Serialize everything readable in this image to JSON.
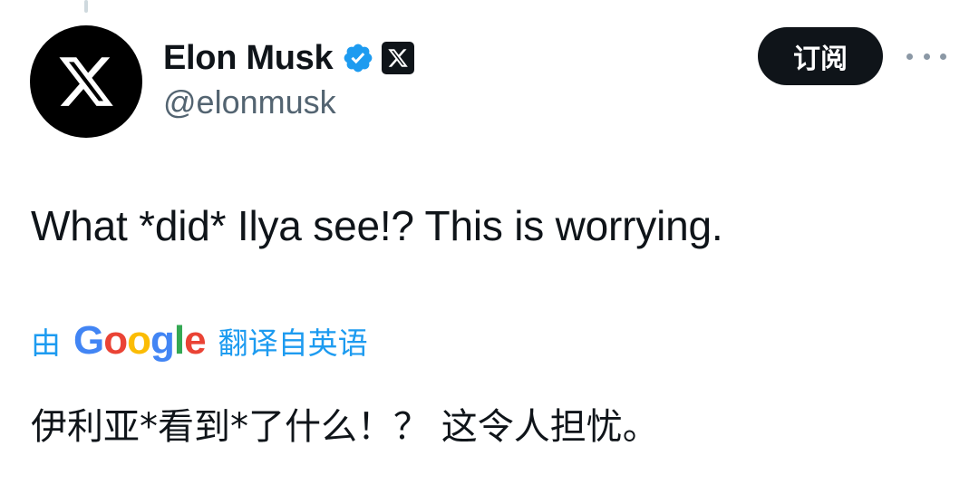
{
  "author": {
    "display_name": "Elon Musk",
    "handle": "@elonmusk",
    "avatar_icon": "x-logo-icon",
    "verified_icon": "verified-badge-icon",
    "affiliation_icon": "x-logo-badge-icon"
  },
  "actions": {
    "subscribe_label": "订阅",
    "more_icon": "more-options-icon"
  },
  "tweet": {
    "text": "What *did* Ilya see!? This is worrying."
  },
  "translation": {
    "by_label": "由",
    "provider": "Google",
    "from_label": "翻译自英语",
    "text": "伊利亚*看到*了什么！？ 这令人担忧。"
  },
  "colors": {
    "link_blue": "#1d9bf0",
    "verified_blue": "#1d9bf0",
    "text_primary": "#0f1419",
    "text_secondary": "#536471",
    "button_dark": "#0f1419"
  }
}
